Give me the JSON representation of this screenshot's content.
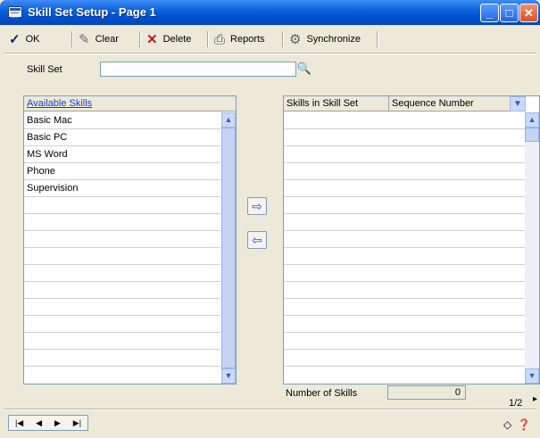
{
  "window": {
    "title": "Skill Set Setup - Page 1"
  },
  "toolbar": {
    "ok_label": "OK",
    "clear_label": "Clear",
    "delete_label": "Delete",
    "reports_label": "Reports",
    "synchronize_label": "Synchronize"
  },
  "form": {
    "skill_set_label": "Skill Set",
    "skill_set_value": ""
  },
  "available_skills": {
    "header": "Available Skills",
    "items": [
      "Basic Mac",
      "Basic PC",
      "MS Word",
      "Phone",
      "Supervision"
    ]
  },
  "skills_in_set": {
    "header_name": "Skills in Skill Set",
    "header_sequence": "Sequence Number"
  },
  "footer": {
    "number_of_skills_label": "Number of Skills",
    "number_of_skills_value": "0",
    "page_indicator": "1/2"
  }
}
